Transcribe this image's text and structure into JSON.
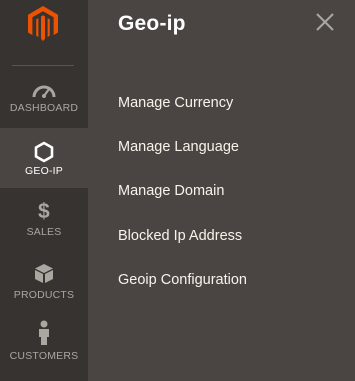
{
  "colors": {
    "sidebar_bg": "#373330",
    "panel_bg": "#4a4542",
    "brand_orange": "#eb5202",
    "nav_text": "#aaa6a0",
    "active_text": "#ffffff"
  },
  "logo": {
    "icon": "magento-logo-icon"
  },
  "sidebar": {
    "items": [
      {
        "label": "DASHBOARD",
        "icon": "gauge-icon",
        "active": false
      },
      {
        "label": "GEO-IP",
        "icon": "hexagon-icon",
        "active": true
      },
      {
        "label": "SALES",
        "icon": "dollar-icon",
        "active": false
      },
      {
        "label": "PRODUCTS",
        "icon": "cube-icon",
        "active": false
      },
      {
        "label": "CUSTOMERS",
        "icon": "person-icon",
        "active": false
      }
    ]
  },
  "panel": {
    "title": "Geo-ip",
    "close_icon": "close-icon",
    "links": [
      "Manage Currency",
      "Manage Language",
      "Manage Domain",
      "Blocked Ip Address",
      "Geoip Configuration"
    ]
  }
}
